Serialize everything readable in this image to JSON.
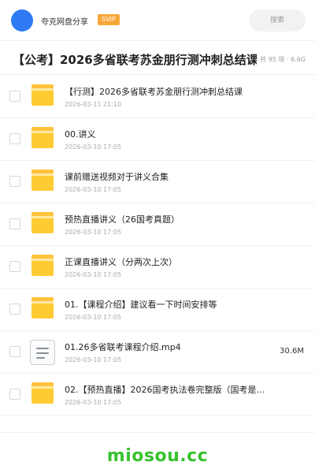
{
  "header": {
    "app_name": "夸克网盘分享",
    "badge": "SVIP",
    "search_label": "搜索"
  },
  "folder": {
    "title": "【公考】2026多省联考苏金朋行测冲刺总结课",
    "meta": "共 95 项 · 6.6G"
  },
  "items": [
    {
      "type": "folder",
      "name": "【行测】2026多省联考苏金朋行测冲刺总结课",
      "date": "2026-03-11 21:10",
      "size": ""
    },
    {
      "type": "folder",
      "name": "00.讲义",
      "date": "2026-03-10 17:05",
      "size": ""
    },
    {
      "type": "folder",
      "name": "课前赠送视频对于讲义合集",
      "date": "2026-03-10 17:05",
      "size": ""
    },
    {
      "type": "folder",
      "name": "预热直播讲义（26国考真题）",
      "date": "2026-03-10 17:05",
      "size": ""
    },
    {
      "type": "folder",
      "name": "正课直播讲义（分两次上次）",
      "date": "2026-03-10 17:05",
      "size": ""
    },
    {
      "type": "folder",
      "name": "01.【课程介绍】建议看一下时间安排等",
      "date": "2026-03-10 17:05",
      "size": ""
    },
    {
      "type": "file",
      "name": "01.26多省联考课程介绍.mp4",
      "date": "2026-03-10 17:05",
      "size": "30.6M"
    },
    {
      "type": "folder",
      "name": "02.【预热直播】2026国考执法卷完整版（国考是…",
      "date": "2026-03-10 17:05",
      "size": ""
    }
  ],
  "watermark": "miosou.cc",
  "colors": {
    "avatar": "#2f7bf5",
    "badge": "#f7a73a",
    "folder": "#ffcb33",
    "watermark": "#38c12f"
  }
}
